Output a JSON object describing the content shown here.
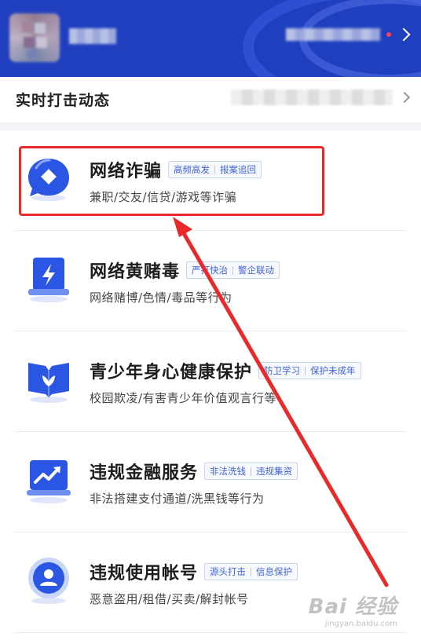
{
  "header": {
    "avatar_icon": "avatar-blurred",
    "colors": {
      "background": "#1f3fbf",
      "notification_dot": "#ff3b5c"
    }
  },
  "live_section": {
    "title": "实时打击动态"
  },
  "categories": [
    {
      "title": "网络诈骗",
      "tags": [
        "高频高发",
        "报案追回"
      ],
      "description": "兼职/交友/信贷/游戏等诈骗",
      "icon": "chat-bubble-diamond-icon"
    },
    {
      "title": "网络黄赌毒",
      "tags": [
        "严打快治",
        "警企联动"
      ],
      "description": "网络赌博/色情/毒品等行为",
      "icon": "lightning-screen-icon"
    },
    {
      "title": "青少年身心健康保护",
      "tags": [
        "防卫学习",
        "保护未成年"
      ],
      "description": "校园欺凌/有害青少年价值观言行等",
      "icon": "open-book-icon"
    },
    {
      "title": "违规金融服务",
      "tags": [
        "非法洗钱",
        "违规集资"
      ],
      "description": "非法搭建支付通道/洗黑钱等行为",
      "icon": "trend-laptop-icon"
    },
    {
      "title": "违规使用帐号",
      "tags": [
        "源头打击",
        "信息保护"
      ],
      "description": "恶意盗用/租借/买卖/解封帐号",
      "icon": "user-badge-icon"
    }
  ],
  "watermark": {
    "main": "Bai 经验",
    "sub": "jingyan.baidu.com"
  },
  "accent_color": "#3d63d9",
  "annotation_color": "#ea2a2a"
}
